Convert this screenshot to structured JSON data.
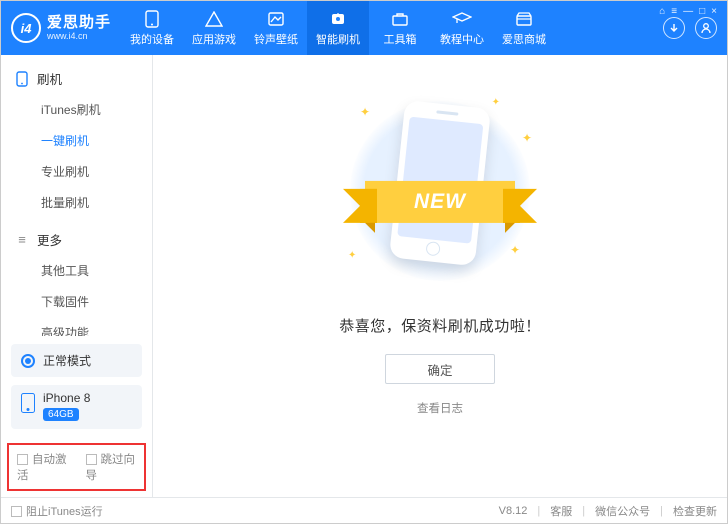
{
  "brand": {
    "name_cn": "爱思助手",
    "name_en": "www.i4.cn",
    "logo": "i4"
  },
  "win_ctrl": {
    "cart": "⌂",
    "menu": "≡",
    "min": "—",
    "max": "□",
    "close": "×"
  },
  "tabs": [
    {
      "id": "devices",
      "label": "我的设备"
    },
    {
      "id": "apps",
      "label": "应用游戏"
    },
    {
      "id": "wall",
      "label": "铃声壁纸"
    },
    {
      "id": "flash",
      "label": "智能刷机",
      "active": true
    },
    {
      "id": "tools",
      "label": "工具箱"
    },
    {
      "id": "tut",
      "label": "教程中心"
    },
    {
      "id": "mall",
      "label": "爱思商城"
    }
  ],
  "sidebar": {
    "group_flash": "刷机",
    "items_flash": [
      {
        "label": "iTunes刷机"
      },
      {
        "label": "一键刷机",
        "active": true
      },
      {
        "label": "专业刷机"
      },
      {
        "label": "批量刷机"
      }
    ],
    "group_more": "更多",
    "items_more": [
      {
        "label": "其他工具"
      },
      {
        "label": "下载固件"
      },
      {
        "label": "高级功能"
      }
    ],
    "mode": "正常模式",
    "device": {
      "name": "iPhone 8",
      "storage": "64GB"
    },
    "opt_auto": "自动激活",
    "opt_skip": "跳过向导"
  },
  "main": {
    "ribbon": "NEW",
    "message": "恭喜您，保资料刷机成功啦！",
    "ok": "确定",
    "log": "查看日志"
  },
  "footer": {
    "block": "阻止iTunes运行",
    "version": "V8.12",
    "svc": "客服",
    "wechat": "微信公众号",
    "update": "检查更新"
  }
}
